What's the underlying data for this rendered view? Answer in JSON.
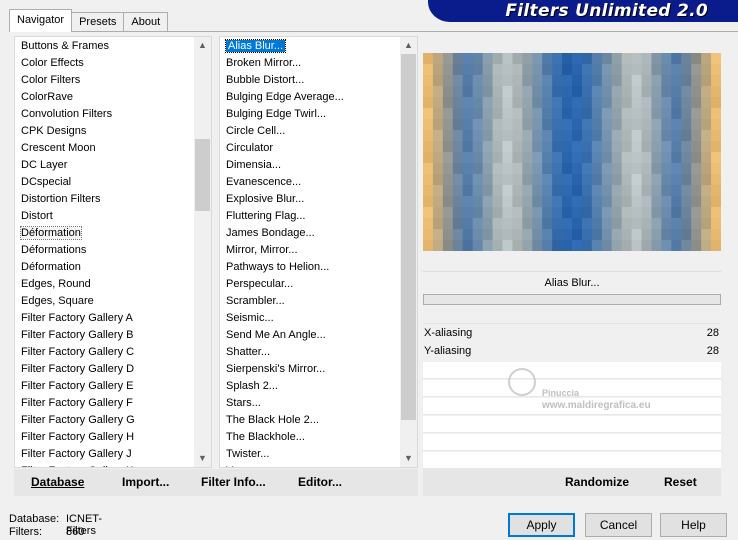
{
  "tabs": [
    "Navigator",
    "Presets",
    "About"
  ],
  "banner": {
    "title": "Filters Unlimited 2.0"
  },
  "categories": {
    "items": [
      "Buttons & Frames",
      "Color Effects",
      "Color Filters",
      "ColorRave",
      "Convolution Filters",
      "CPK Designs",
      "Crescent Moon",
      "DC Layer",
      "DCspecial",
      "Distortion Filters",
      "Distort",
      "Déformation",
      "Déformations",
      "Déformation",
      "Edges, Round",
      "Edges, Square",
      "Filter Factory Gallery A",
      "Filter Factory Gallery B",
      "Filter Factory Gallery C",
      "Filter Factory Gallery D",
      "Filter Factory Gallery E",
      "Filter Factory Gallery F",
      "Filter Factory Gallery G",
      "Filter Factory Gallery H",
      "Filter Factory Gallery J",
      "Filter Factory Gallery K"
    ],
    "selected_index": 11
  },
  "filters": {
    "items": [
      "Alias Blur...",
      "Broken Mirror...",
      "Bubble Distort...",
      "Bulging Edge Average...",
      "Bulging Edge Twirl...",
      "Circle Cell...",
      "Circulator",
      "Dimensia...",
      "Evanescence...",
      "Explosive Blur...",
      "Fluttering Flag...",
      "James Bondage...",
      "Mirror, Mirror...",
      "Pathways to Helion...",
      "Perspecular...",
      "Scrambler...",
      "Seismic...",
      "Send Me An Angle...",
      "Shatter...",
      "Sierpenski's Mirror...",
      "Splash 2...",
      "Stars...",
      "The Black Hole 2...",
      "The Blackhole...",
      "Twister...",
      "Vacuum..."
    ],
    "selected_index": 0
  },
  "selected_filter_title": "Alias Blur...",
  "params": [
    {
      "label": "X-aliasing",
      "value": "28"
    },
    {
      "label": "Y-aliasing",
      "value": "28"
    }
  ],
  "watermark": {
    "name": "Pinuccia",
    "url": "www.maldiregrafica.eu"
  },
  "bottom_left": {
    "database": "Database",
    "import": "Import...",
    "filter_info": "Filter Info...",
    "editor": "Editor..."
  },
  "bottom_right": {
    "randomize": "Randomize",
    "reset": "Reset"
  },
  "status": {
    "database_label": "Database:",
    "database_value": "ICNET-Filters",
    "filters_label": "Filters:",
    "filters_value": "860"
  },
  "buttons": {
    "apply": "Apply",
    "cancel": "Cancel",
    "help": "Help"
  },
  "colors": {
    "banner": "#0a1b8c",
    "selection": "#0078d7",
    "preview_blue": "#2f6bb5",
    "preview_gold": "#e8b96a"
  }
}
